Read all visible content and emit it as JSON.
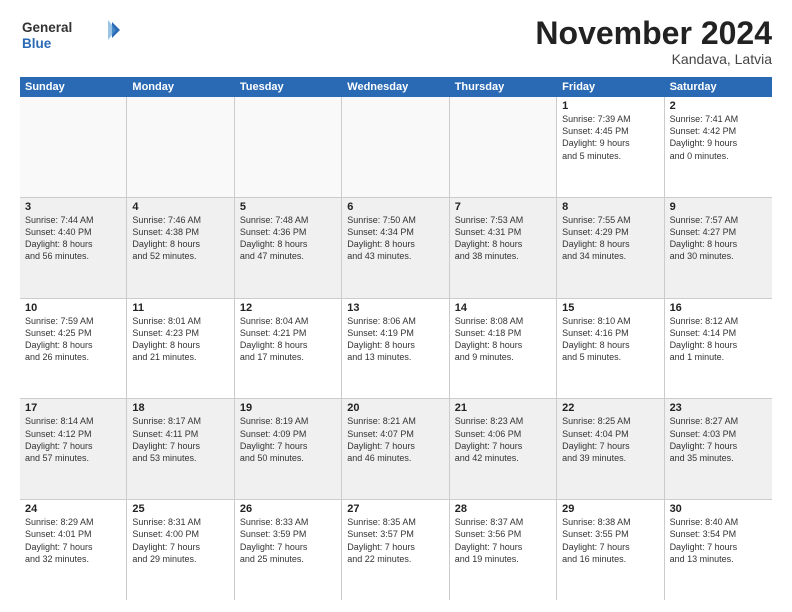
{
  "logo": {
    "line1": "General",
    "line2": "Blue"
  },
  "title": "November 2024",
  "location": "Kandava, Latvia",
  "weekdays": [
    "Sunday",
    "Monday",
    "Tuesday",
    "Wednesday",
    "Thursday",
    "Friday",
    "Saturday"
  ],
  "rows": [
    [
      {
        "day": "",
        "info": ""
      },
      {
        "day": "",
        "info": ""
      },
      {
        "day": "",
        "info": ""
      },
      {
        "day": "",
        "info": ""
      },
      {
        "day": "",
        "info": ""
      },
      {
        "day": "1",
        "info": "Sunrise: 7:39 AM\nSunset: 4:45 PM\nDaylight: 9 hours\nand 5 minutes."
      },
      {
        "day": "2",
        "info": "Sunrise: 7:41 AM\nSunset: 4:42 PM\nDaylight: 9 hours\nand 0 minutes."
      }
    ],
    [
      {
        "day": "3",
        "info": "Sunrise: 7:44 AM\nSunset: 4:40 PM\nDaylight: 8 hours\nand 56 minutes."
      },
      {
        "day": "4",
        "info": "Sunrise: 7:46 AM\nSunset: 4:38 PM\nDaylight: 8 hours\nand 52 minutes."
      },
      {
        "day": "5",
        "info": "Sunrise: 7:48 AM\nSunset: 4:36 PM\nDaylight: 8 hours\nand 47 minutes."
      },
      {
        "day": "6",
        "info": "Sunrise: 7:50 AM\nSunset: 4:34 PM\nDaylight: 8 hours\nand 43 minutes."
      },
      {
        "day": "7",
        "info": "Sunrise: 7:53 AM\nSunset: 4:31 PM\nDaylight: 8 hours\nand 38 minutes."
      },
      {
        "day": "8",
        "info": "Sunrise: 7:55 AM\nSunset: 4:29 PM\nDaylight: 8 hours\nand 34 minutes."
      },
      {
        "day": "9",
        "info": "Sunrise: 7:57 AM\nSunset: 4:27 PM\nDaylight: 8 hours\nand 30 minutes."
      }
    ],
    [
      {
        "day": "10",
        "info": "Sunrise: 7:59 AM\nSunset: 4:25 PM\nDaylight: 8 hours\nand 26 minutes."
      },
      {
        "day": "11",
        "info": "Sunrise: 8:01 AM\nSunset: 4:23 PM\nDaylight: 8 hours\nand 21 minutes."
      },
      {
        "day": "12",
        "info": "Sunrise: 8:04 AM\nSunset: 4:21 PM\nDaylight: 8 hours\nand 17 minutes."
      },
      {
        "day": "13",
        "info": "Sunrise: 8:06 AM\nSunset: 4:19 PM\nDaylight: 8 hours\nand 13 minutes."
      },
      {
        "day": "14",
        "info": "Sunrise: 8:08 AM\nSunset: 4:18 PM\nDaylight: 8 hours\nand 9 minutes."
      },
      {
        "day": "15",
        "info": "Sunrise: 8:10 AM\nSunset: 4:16 PM\nDaylight: 8 hours\nand 5 minutes."
      },
      {
        "day": "16",
        "info": "Sunrise: 8:12 AM\nSunset: 4:14 PM\nDaylight: 8 hours\nand 1 minute."
      }
    ],
    [
      {
        "day": "17",
        "info": "Sunrise: 8:14 AM\nSunset: 4:12 PM\nDaylight: 7 hours\nand 57 minutes."
      },
      {
        "day": "18",
        "info": "Sunrise: 8:17 AM\nSunset: 4:11 PM\nDaylight: 7 hours\nand 53 minutes."
      },
      {
        "day": "19",
        "info": "Sunrise: 8:19 AM\nSunset: 4:09 PM\nDaylight: 7 hours\nand 50 minutes."
      },
      {
        "day": "20",
        "info": "Sunrise: 8:21 AM\nSunset: 4:07 PM\nDaylight: 7 hours\nand 46 minutes."
      },
      {
        "day": "21",
        "info": "Sunrise: 8:23 AM\nSunset: 4:06 PM\nDaylight: 7 hours\nand 42 minutes."
      },
      {
        "day": "22",
        "info": "Sunrise: 8:25 AM\nSunset: 4:04 PM\nDaylight: 7 hours\nand 39 minutes."
      },
      {
        "day": "23",
        "info": "Sunrise: 8:27 AM\nSunset: 4:03 PM\nDaylight: 7 hours\nand 35 minutes."
      }
    ],
    [
      {
        "day": "24",
        "info": "Sunrise: 8:29 AM\nSunset: 4:01 PM\nDaylight: 7 hours\nand 32 minutes."
      },
      {
        "day": "25",
        "info": "Sunrise: 8:31 AM\nSunset: 4:00 PM\nDaylight: 7 hours\nand 29 minutes."
      },
      {
        "day": "26",
        "info": "Sunrise: 8:33 AM\nSunset: 3:59 PM\nDaylight: 7 hours\nand 25 minutes."
      },
      {
        "day": "27",
        "info": "Sunrise: 8:35 AM\nSunset: 3:57 PM\nDaylight: 7 hours\nand 22 minutes."
      },
      {
        "day": "28",
        "info": "Sunrise: 8:37 AM\nSunset: 3:56 PM\nDaylight: 7 hours\nand 19 minutes."
      },
      {
        "day": "29",
        "info": "Sunrise: 8:38 AM\nSunset: 3:55 PM\nDaylight: 7 hours\nand 16 minutes."
      },
      {
        "day": "30",
        "info": "Sunrise: 8:40 AM\nSunset: 3:54 PM\nDaylight: 7 hours\nand 13 minutes."
      }
    ]
  ]
}
